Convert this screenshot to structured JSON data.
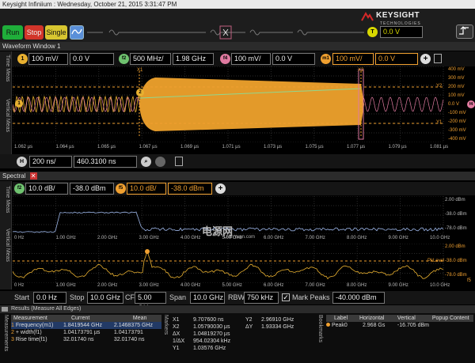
{
  "window_title": "Keysight Infiniium : Wednesday, October 21, 2015 3:31:47 PM",
  "brand": {
    "name": "KEYSIGHT",
    "sub": "TECHNOLOGIES"
  },
  "toolbar": {
    "run": "Run",
    "stop": "Stop",
    "single": "Single",
    "trigger_level_label": "T",
    "trigger_level": "0.0 V"
  },
  "colors": {
    "accent_orange": "#f0a030",
    "accent_yellow": "#d8d800",
    "accent_pink": "#e07aa0",
    "run_green": "#1fae3a",
    "stop_red": "#d2352a"
  },
  "waveform_window": {
    "title": "Waveform Window 1",
    "ch1": {
      "badge": "1",
      "scale": "100 mV/",
      "offset": "0.0 V"
    },
    "f2": {
      "badge": "f2",
      "scale": "500 MHz/",
      "offset": "1.98 GHz"
    },
    "f4": {
      "badge": "f4",
      "scale": "100 mV/",
      "offset": "0.0 V"
    },
    "m1": {
      "badge": "m1",
      "scale": "100 mV/",
      "offset": "0.0 V"
    },
    "side_labels": [
      "Time Meas",
      "Vertical Meas"
    ],
    "markers": {
      "x1": "X1",
      "x2": "X2",
      "y1": "Y1",
      "y2": "Y2"
    },
    "right_axis": [
      "400 mV",
      "300 mV",
      "200 mV",
      "100 mV",
      "0.0 V",
      "-100 mV",
      "-200 mV",
      "-300 mV",
      "-400 mV"
    ],
    "time_axis": [
      "1.062 µs",
      "1.064 µs",
      "1.065 µs",
      "1.067 µs",
      "1.069 µs",
      "1.071 µs",
      "1.073 µs",
      "1.075 µs",
      "1.077 µs",
      "1.079 µs",
      "1.081 µs"
    ],
    "trace_badges": [
      "1",
      "2",
      "f4"
    ],
    "horizontal": {
      "badge": "H",
      "scale": "200 ns/",
      "position": "460.3100 ns"
    }
  },
  "spectral": {
    "title": "Spectral",
    "side_labels": [
      "Time Meas",
      "Vertical Meas"
    ],
    "f2_ctrl": {
      "scale": "10.0 dB/",
      "ref": "-38.0 dBm"
    },
    "f5_ctrl": {
      "scale": "10.0 dB/",
      "ref": "-38.0 dBm"
    },
    "upper_axis": [
      "2.00 dBm",
      "-38.0 dBm",
      "-78.0 dBm"
    ],
    "lower_axis": [
      "2.00 dBm",
      "-38.0 dBm",
      "-78.0 dBm"
    ],
    "lower_trace_label": "f5",
    "pk_level": "PkLevel",
    "freq_axis": [
      "0 Hz",
      "1.00 GHz",
      "2.00 GHz",
      "3.00 GHz",
      "4.00 GHz",
      "5.00 GHz",
      "6.00 GHz",
      "7.00 GHz",
      "8.00 GHz",
      "9.00 GHz",
      "10.0 GHz"
    ],
    "bottom_ctrl": {
      "start_label": "Start",
      "start": "0.0 Hz",
      "stop_label": "Stop",
      "stop": "10.0 GHz",
      "cf_label": "CF",
      "cf": "5.00 GHz",
      "span_label": "Span",
      "span": "10.0 GHz",
      "rbw_label": "RBW",
      "rbw": "750 kHz",
      "mark_peaks_label": "Mark Peaks",
      "mark_peaks_checked": true,
      "threshold": "-40.000 dBm"
    }
  },
  "watermark": {
    "text": "电源网",
    "sub": "DianYuan.com"
  },
  "results": {
    "title": "Results",
    "subtitle": "(Measure All Edges)",
    "side_label": "Measurements",
    "columns": [
      "Measurement",
      "Current",
      "Mean"
    ],
    "rows": [
      {
        "icon": "1",
        "name": "Frequency(m1)",
        "current": "1.8419544 GHz",
        "mean": "2.1468375 GHz"
      },
      {
        "icon": "2",
        "name": "+ width(f1)",
        "current": "1.04173791 µs",
        "mean": "1.04173791"
      },
      {
        "icon": "3",
        "name": "Rise time(f1)",
        "current": "32.01740 ns",
        "mean": "32.01740 ns"
      }
    ],
    "markers_label": "Markers",
    "markers": [
      {
        "k1": "X1",
        "v1": "9.707600 ns",
        "k2": "Y2",
        "v2": "2.96910 GHz"
      },
      {
        "k1": "X2",
        "v1": "1.05790030 µs",
        "k2": "ΔY",
        "v2": "1.93334 GHz"
      },
      {
        "k1": "ΔX",
        "v1": "1.04819270 µs",
        "k2": "",
        "v2": ""
      },
      {
        "k1": "1/ΔX",
        "v1": "954.02304 kHz",
        "k2": "",
        "v2": ""
      },
      {
        "k1": "Y1",
        "v1": "1.03576 GHz",
        "k2": "",
        "v2": ""
      }
    ],
    "bookmarks_label": "Bookmarks",
    "peaks_columns": [
      "Label",
      "Horizontal",
      "Vertical",
      "Popup Content"
    ],
    "peaks": [
      {
        "label": "Peak0",
        "horizontal": "2.968 Gs",
        "vertical": "-16.705 dBm"
      }
    ]
  }
}
